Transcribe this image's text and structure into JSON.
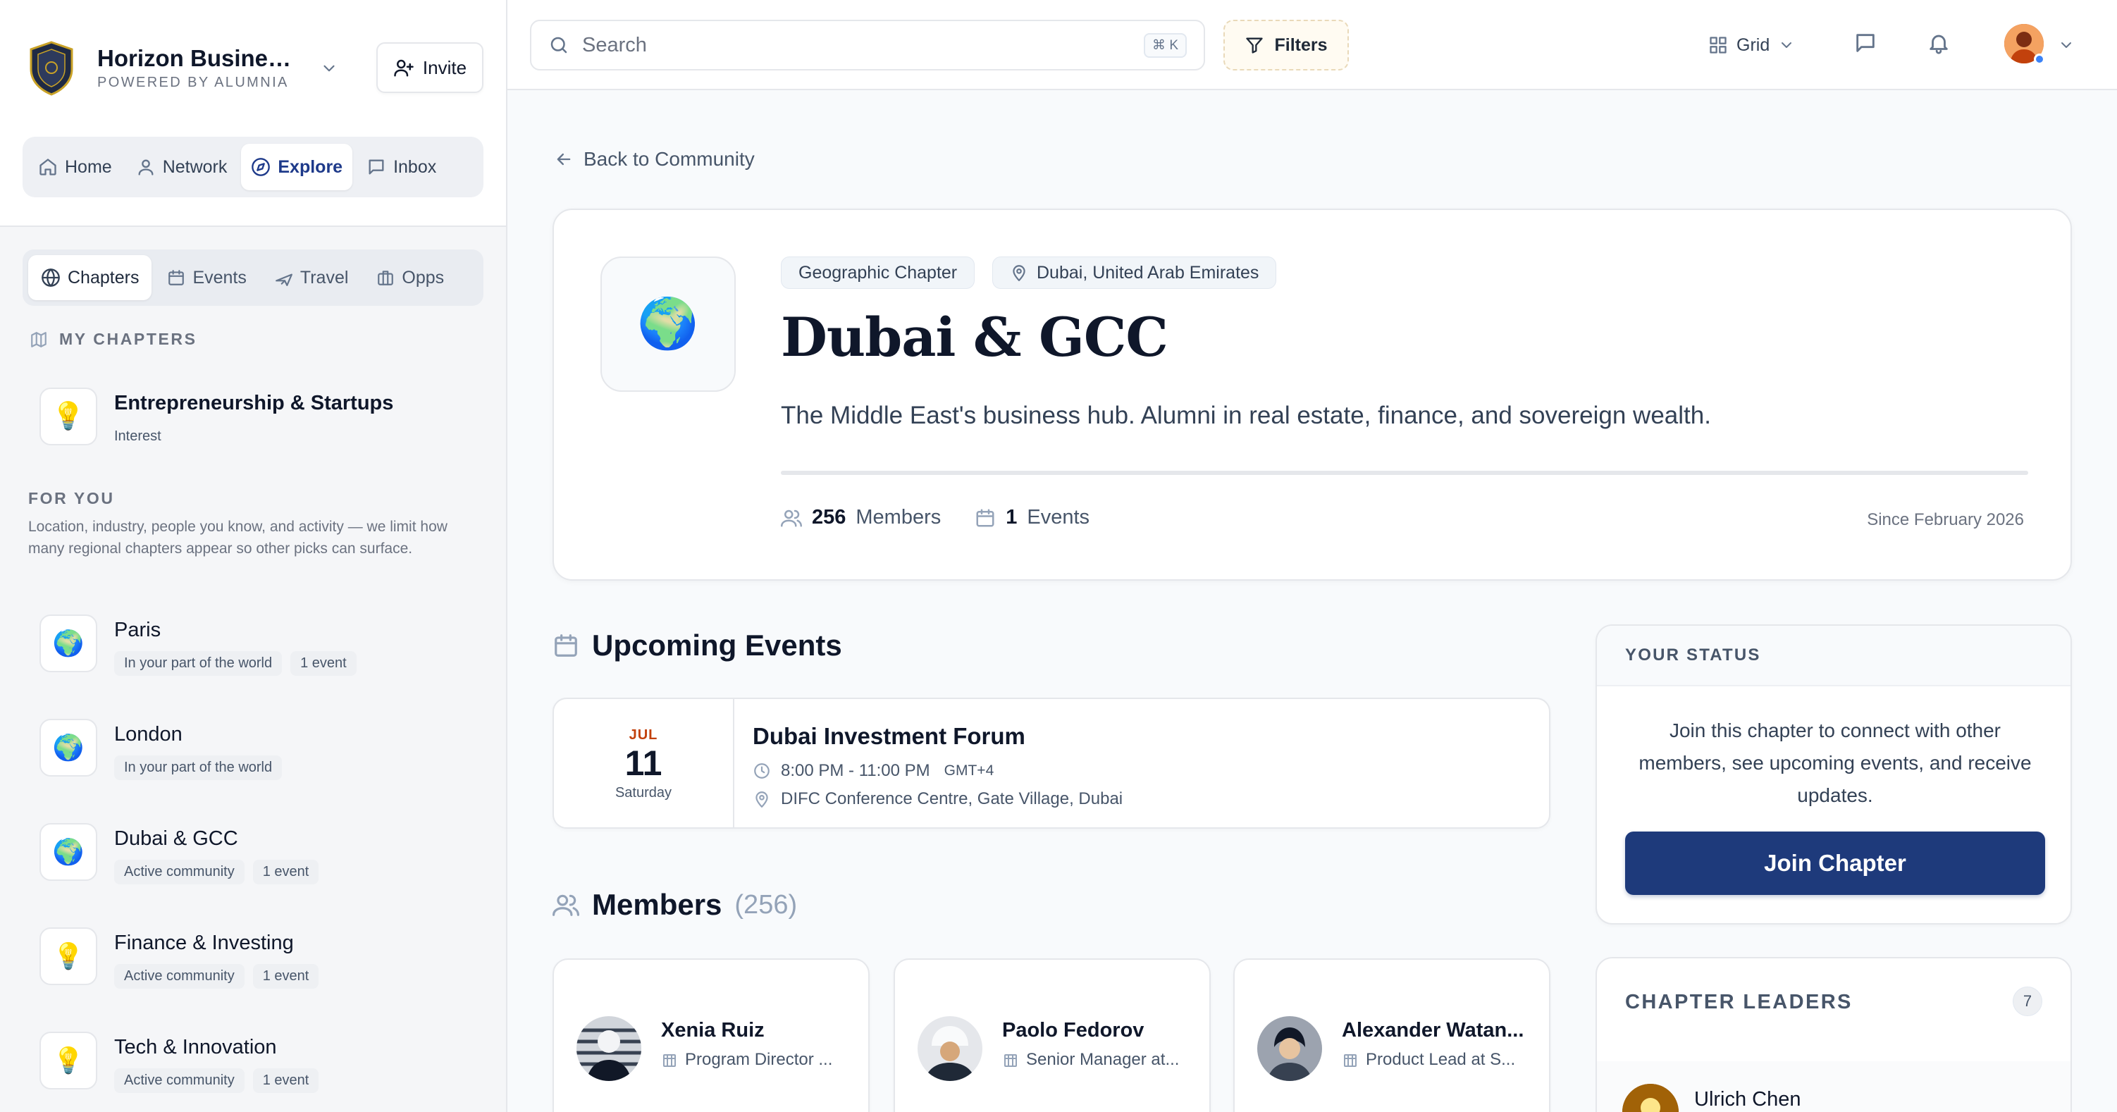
{
  "brand": {
    "name": "Horizon Business...",
    "subtitle": "POWERED BY ALUMNIA",
    "invite_label": "Invite"
  },
  "main_nav": [
    {
      "label": "Home",
      "icon": "home-icon",
      "active": false
    },
    {
      "label": "Network",
      "icon": "users-icon",
      "active": false
    },
    {
      "label": "Explore",
      "icon": "compass-icon",
      "active": true
    },
    {
      "label": "Inbox",
      "icon": "message-icon",
      "active": false
    }
  ],
  "sub_nav": [
    {
      "label": "Chapters",
      "icon": "globe-icon",
      "active": true
    },
    {
      "label": "Events",
      "icon": "calendar-icon",
      "active": false
    },
    {
      "label": "Travel",
      "icon": "plane-icon",
      "active": false
    },
    {
      "label": "Opps",
      "icon": "briefcase-icon",
      "active": false
    }
  ],
  "my_chapters": {
    "heading": "MY CHAPTERS",
    "items": [
      {
        "name": "Entrepreneurship & Startups",
        "icon": "lightbulb-icon",
        "meta": [
          "Interest"
        ]
      }
    ]
  },
  "for_you": {
    "heading": "FOR YOU",
    "description": "Location, industry, people you know, and activity — we limit how many regional chapters appear so other picks can surface.",
    "items": [
      {
        "name": "Paris",
        "icon": "globe-emoji-icon",
        "meta": [
          "In your part of the world",
          "1 event"
        ]
      },
      {
        "name": "London",
        "icon": "globe-emoji-icon",
        "meta": [
          "In your part of the world"
        ]
      },
      {
        "name": "Dubai & GCC",
        "icon": "globe-emoji-icon",
        "meta": [
          "Active community",
          "1 event"
        ]
      },
      {
        "name": "Finance & Investing",
        "icon": "lightbulb-icon",
        "meta": [
          "Active community",
          "1 event"
        ]
      },
      {
        "name": "Tech & Innovation",
        "icon": "lightbulb-icon",
        "meta": [
          "Active community",
          "1 event"
        ]
      }
    ]
  },
  "topbar": {
    "search_placeholder": "Search",
    "search_shortcut": "⌘ K",
    "filters_label": "Filters",
    "view_label": "Grid"
  },
  "back_link": "Back to Community",
  "chapter": {
    "type_tag": "Geographic Chapter",
    "location": "Dubai, United Arab Emirates",
    "title": "Dubai & GCC",
    "description": "The Middle East's business hub. Alumni in real estate, finance, and sovereign wealth.",
    "members_count": "256",
    "members_label": "Members",
    "events_count": "1",
    "events_label": "Events",
    "since": "Since February 2026"
  },
  "upcoming_events": {
    "heading": "Upcoming Events",
    "items": [
      {
        "month": "JUL",
        "day": "11",
        "weekday": "Saturday",
        "title": "Dubai Investment Forum",
        "time": "8:00 PM - 11:00 PM",
        "timezone": "GMT+4",
        "location": "DIFC Conference Centre, Gate Village, Dubai"
      }
    ]
  },
  "members": {
    "heading": "Members",
    "count": "(256)",
    "items": [
      {
        "name": "Xenia Ruiz",
        "role": "Program Director ..."
      },
      {
        "name": "Paolo Fedorov",
        "role": "Senior Manager at..."
      },
      {
        "name": "Alexander Watan...",
        "role": "Product Lead at S..."
      }
    ]
  },
  "status": {
    "heading": "YOUR STATUS",
    "text": "Join this chapter to connect with other members, see upcoming events, and receive updates.",
    "join_label": "Join Chapter"
  },
  "leaders": {
    "heading": "CHAPTER LEADERS",
    "count": "7",
    "items": [
      {
        "name": "Ulrich Chen"
      }
    ]
  },
  "colors": {
    "accent": "#1e3a7b",
    "active_nav": "#1e3a8a",
    "event_month": "#c2410c"
  }
}
